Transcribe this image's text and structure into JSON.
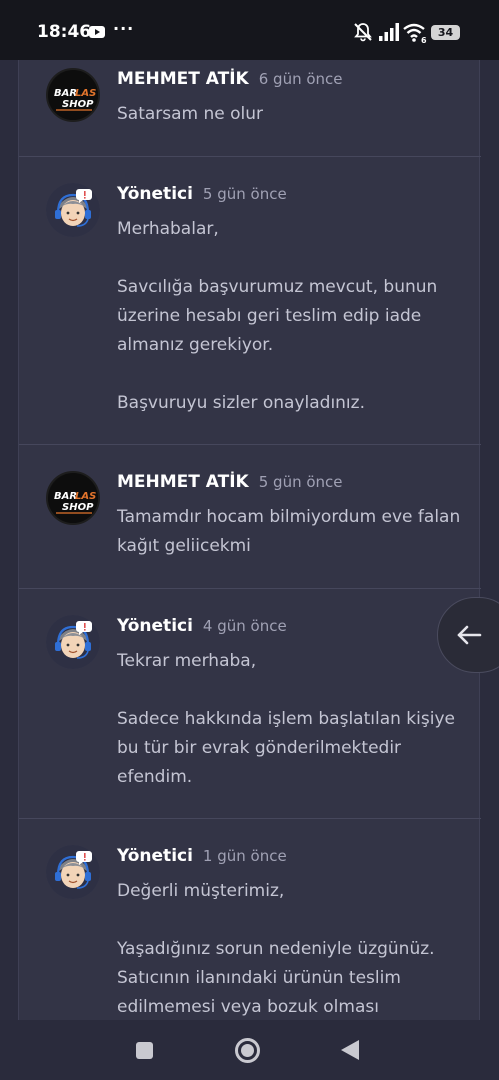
{
  "status_bar": {
    "time": "18:46",
    "notification_icons": [
      "youtube-icon",
      "more-dots-icon"
    ],
    "system_icons": [
      "mute-icon",
      "signal-icon",
      "wifi-icon"
    ],
    "wifi_label": "6",
    "battery": "34",
    "dots": "···"
  },
  "comments": [
    {
      "author": "MEHMET ATİK",
      "time": "6 gün önce",
      "avatar": "barlas-shop-logo",
      "paragraphs": [
        "Satarsam ne olur"
      ]
    },
    {
      "author": "Yönetici",
      "time": "5 gün önce",
      "avatar": "support-agent-avatar",
      "paragraphs": [
        "Merhabalar,",
        "Savcılığa başvurumuz mevcut, bunun üzerine hesabı geri teslim edip iade almanız gerekiyor.",
        "Başvuruyu sizler onayladınız."
      ]
    },
    {
      "author": "MEHMET ATİK",
      "time": "5 gün önce",
      "avatar": "barlas-shop-logo",
      "paragraphs": [
        "Tamamdır hocam bilmiyordum eve falan kağıt geliicekmi"
      ]
    },
    {
      "author": "Yönetici",
      "time": "4 gün önce",
      "avatar": "support-agent-avatar",
      "paragraphs": [
        "Tekrar merhaba,",
        "Sadece hakkında işlem başlatılan kişiye bu tür bir evrak gönderilmektedir efendim."
      ]
    },
    {
      "author": "Yönetici",
      "time": "1 gün önce",
      "avatar": "support-agent-avatar",
      "paragraphs": [
        "Değerli müşterimiz,",
        "Yaşadığınız sorun nedeniyle üzgünüz. Satıcının ilanındaki ürünün teslim edilmemesi veya bozuk olması"
      ]
    }
  ],
  "logo": {
    "line1_a": "BAR",
    "line1_b": "LAS",
    "line2": "SHOP"
  },
  "floating_button": {
    "icon": "arrow-left-icon"
  },
  "nav_bar": {
    "icons": [
      "recents-square-icon",
      "home-circle-icon",
      "back-triangle-icon"
    ]
  },
  "colors": {
    "background": "#2b2c3d",
    "panel": "#333446",
    "author": "#ffffff",
    "text": "#c4c5d3",
    "time": "#a0a1b4",
    "logo_accent": "#e2742c"
  }
}
